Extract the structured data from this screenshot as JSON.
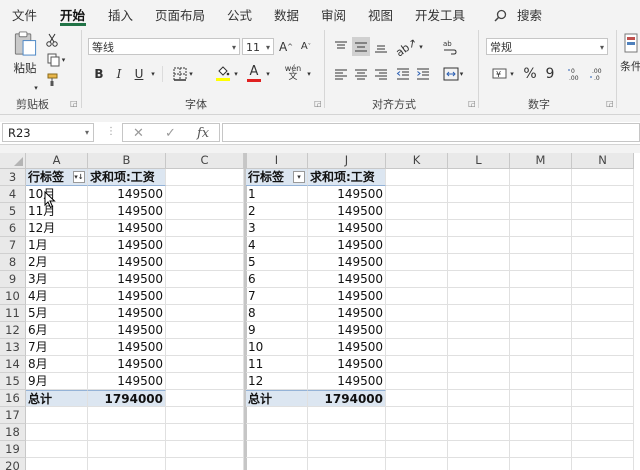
{
  "menu": {
    "items": [
      "文件",
      "开始",
      "插入",
      "页面布局",
      "公式",
      "数据",
      "审阅",
      "视图",
      "开发工具"
    ],
    "search_label": "搜索"
  },
  "ribbon": {
    "clipboard": {
      "paste_label": "粘贴",
      "group_label": "剪贴板"
    },
    "font": {
      "font_name": "等线",
      "font_size": "11",
      "bold": "B",
      "italic": "I",
      "underline": "U",
      "fill_letter": "A",
      "phonetic": "wén",
      "group_label": "字体",
      "grow": "A",
      "shrink": "A"
    },
    "alignment": {
      "group_label": "对齐方式"
    },
    "number": {
      "format": "常规",
      "percent": "%",
      "comma": "9",
      "group_label": "数字"
    },
    "styles": {
      "cond_format_label": "条件"
    }
  },
  "formula_bar": {
    "name_box": "R23",
    "fx_label": "fx",
    "formula": ""
  },
  "sheet": {
    "columns": [
      "A",
      "B",
      "C",
      "I",
      "J",
      "K",
      "L",
      "M",
      "N"
    ],
    "rows": [
      "3",
      "4",
      "5",
      "6",
      "7",
      "8",
      "9",
      "10",
      "11",
      "12",
      "13",
      "14",
      "15",
      "16",
      "17",
      "18",
      "19",
      "20"
    ],
    "pivot1": {
      "header_label": "行标签",
      "header_value": "求和项:工资",
      "labels": [
        "10月",
        "11月",
        "12月",
        "1月",
        "2月",
        "3月",
        "4月",
        "5月",
        "6月",
        "7月",
        "8月",
        "9月"
      ],
      "values": [
        "149500",
        "149500",
        "149500",
        "149500",
        "149500",
        "149500",
        "149500",
        "149500",
        "149500",
        "149500",
        "149500",
        "149500"
      ],
      "total_label": "总计",
      "total_value": "1794000"
    },
    "pivot2": {
      "header_label": "行标签",
      "header_value": "求和项:工资",
      "labels": [
        "1",
        "2",
        "3",
        "4",
        "5",
        "6",
        "7",
        "8",
        "9",
        "10",
        "11",
        "12"
      ],
      "values": [
        "149500",
        "149500",
        "149500",
        "149500",
        "149500",
        "149500",
        "149500",
        "149500",
        "149500",
        "149500",
        "149500",
        "149500"
      ],
      "total_label": "总计",
      "total_value": "1794000"
    }
  }
}
